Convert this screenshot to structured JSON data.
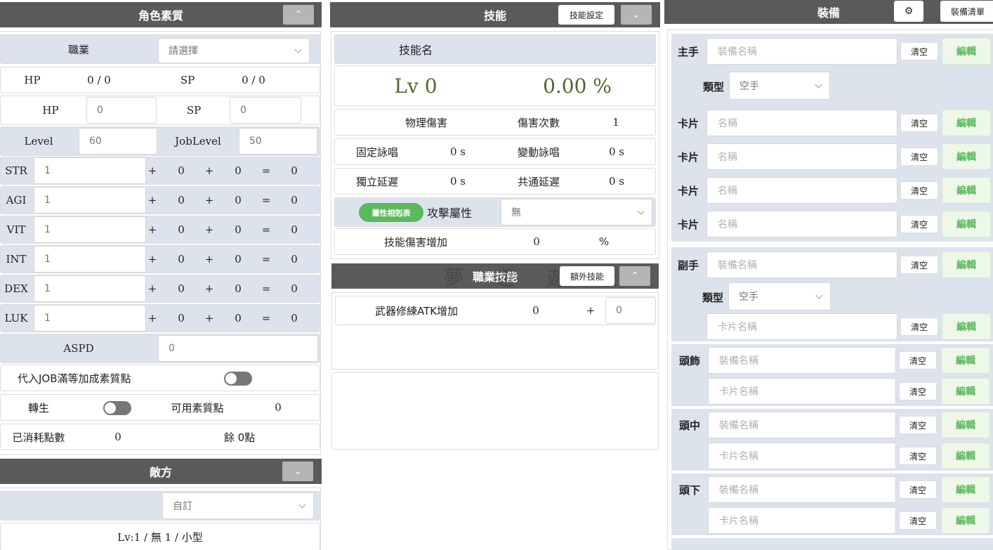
{
  "attributes": {
    "title": "角色素質",
    "toggle_icon": "chevron-up-icon",
    "job_label": "職業",
    "job_select": "請選擇",
    "hp_label": "HP",
    "hp_value": "0 / 0",
    "sp_label": "SP",
    "sp_value": "0 / 0",
    "hp_input_label": "HP",
    "hp_input": "0",
    "sp_input_label": "SP",
    "sp_input": "0",
    "level_label": "Level",
    "level_value": "60",
    "joblevel_label": "JobLevel",
    "joblevel_value": "50",
    "stats": [
      {
        "name": "STR",
        "base": "1",
        "plus1": "+",
        "bonus1": "0",
        "plus2": "+",
        "bonus2": "0",
        "eq": "=",
        "total": "0"
      },
      {
        "name": "AGI",
        "base": "1",
        "plus1": "+",
        "bonus1": "0",
        "plus2": "+",
        "bonus2": "0",
        "eq": "=",
        "total": "0"
      },
      {
        "name": "VIT",
        "base": "1",
        "plus1": "+",
        "bonus1": "0",
        "plus2": "+",
        "bonus2": "0",
        "eq": "=",
        "total": "0"
      },
      {
        "name": "INT",
        "base": "1",
        "plus1": "+",
        "bonus1": "0",
        "plus2": "+",
        "bonus2": "0",
        "eq": "=",
        "total": "0"
      },
      {
        "name": "DEX",
        "base": "1",
        "plus1": "+",
        "bonus1": "0",
        "plus2": "+",
        "bonus2": "0",
        "eq": "=",
        "total": "0"
      },
      {
        "name": "LUK",
        "base": "1",
        "plus1": "+",
        "bonus1": "0",
        "plus2": "+",
        "bonus2": "0",
        "eq": "=",
        "total": "0"
      }
    ],
    "aspd_label": "ASPD",
    "aspd_value": "0",
    "job_max_label": "代入JOB滿等加成素質點",
    "rebirth_label": "轉生",
    "available_points_label": "可用素質點",
    "available_points_value": "0",
    "used_points_label": "已消耗點數",
    "used_points_value": "0",
    "remaining_points": "餘 0點"
  },
  "enemy": {
    "title": "敵方",
    "toggle_icon": "chevron-down-icon",
    "select": "自訂",
    "summary": "Lv:1 / 無 1 / 小型"
  },
  "skill": {
    "title": "技能",
    "settings_button": "技能設定",
    "toggle_icon": "chevron-down-icon",
    "name_label": "技能名",
    "level": "Lv 0",
    "percent": "0.00 %",
    "damage_type": "物理傷害",
    "hit_count_label": "傷害次數",
    "hit_count_value": "1",
    "fixed_cast_label": "固定詠唱",
    "fixed_cast_value": "0 s",
    "var_cast_label": "變動詠唱",
    "var_cast_value": "0 s",
    "delay_label": "獨立延遲",
    "delay_value": "0 s",
    "global_delay_label": "共通延遲",
    "global_delay_value": "0 s",
    "element_table_button": "屬性相剋表",
    "attack_element_label": "攻擊屬性",
    "attack_element_value": "無",
    "damage_bonus_label": "技能傷害增加",
    "damage_bonus_value": "0",
    "damage_bonus_unit": "%"
  },
  "job_skill": {
    "title": "職業技能",
    "extra_button": "額外技能",
    "toggle_icon": "chevron-up-icon",
    "mastery_label": "武器修練ATK增加",
    "mastery_value": "0",
    "mastery_plus": "+",
    "mastery_input": "0"
  },
  "watermark": "夢 遊 遊 玩",
  "equipment": {
    "title": "裝備",
    "settings_icon": "gear-icon",
    "list_button": "裝備清單",
    "clear_label": "清空",
    "edit_label": "編輯",
    "main_hand_label": "主手",
    "equip_placeholder": "裝備名稱",
    "type_label": "類型",
    "type_value": "空手",
    "card_label": "卡片",
    "card_placeholder": "名稱",
    "off_hand_label": "副手",
    "off_type_label": "類型",
    "off_type_value": "空手",
    "card_name_placeholder": "卡片名稱",
    "head_top_label": "頭飾",
    "head_mid_label": "頭中",
    "head_low_label": "頭下"
  }
}
